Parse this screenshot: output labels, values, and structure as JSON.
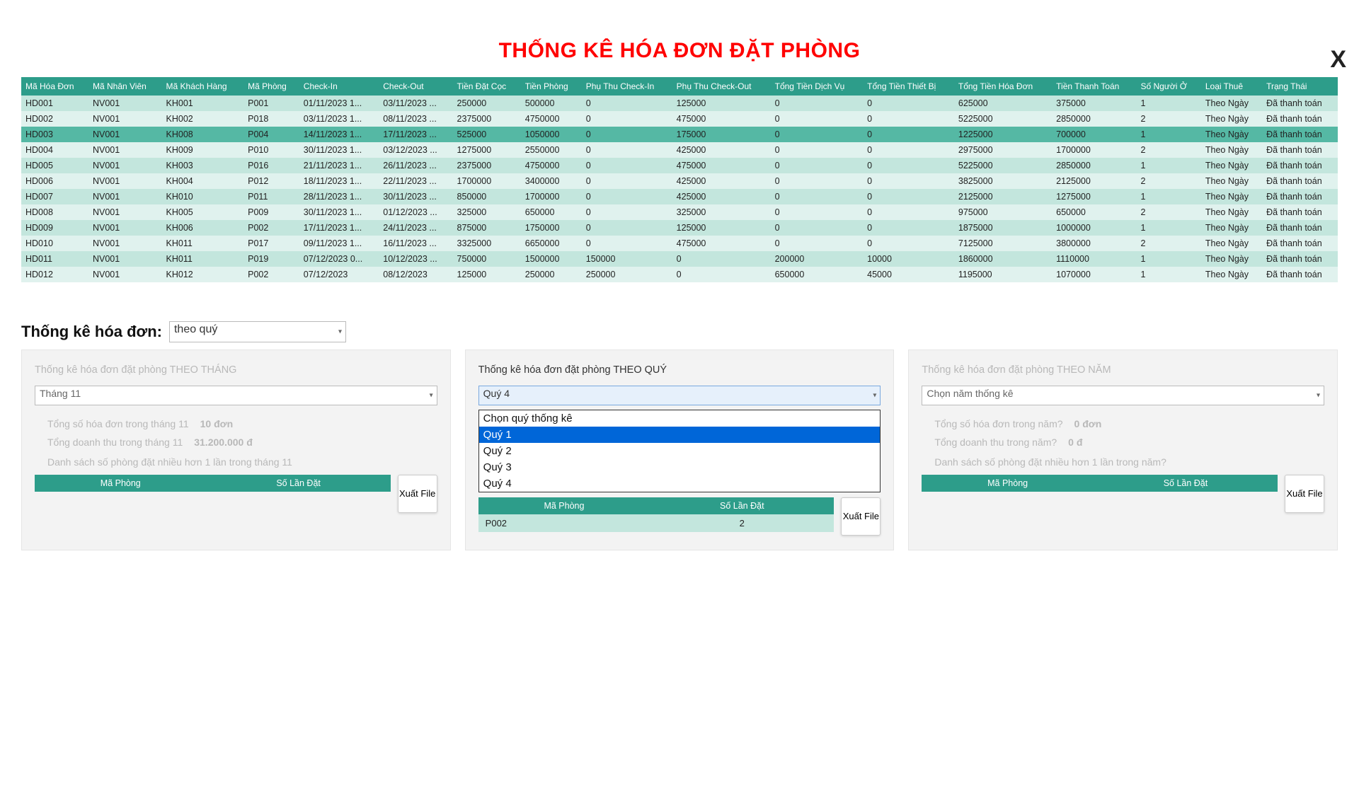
{
  "close_label": "X",
  "title": "THỐNG KÊ HÓA ĐƠN ĐẶT PHÒNG",
  "columns": [
    "Mã Hóa Đơn",
    "Mã Nhân Viên",
    "Mã Khách Hàng",
    "Mã Phòng",
    "Check-In",
    "Check-Out",
    "Tiền Đặt Cọc",
    "Tiền Phòng",
    "Phụ Thu Check-In",
    "Phụ Thu Check-Out",
    "Tổng Tiền Dịch Vụ",
    "Tổng Tiền Thiết Bị",
    "Tổng Tiền Hóa Đơn",
    "Tiền Thanh Toán",
    "Số Người Ở",
    "Loại Thuê",
    "Trạng Thái"
  ],
  "rows": [
    [
      "HD001",
      "NV001",
      "KH001",
      "P001",
      "01/11/2023 1...",
      "03/11/2023 ...",
      "250000",
      "500000",
      "0",
      "125000",
      "0",
      "0",
      "625000",
      "375000",
      "1",
      "Theo Ngày",
      "Đã thanh toán"
    ],
    [
      "HD002",
      "NV001",
      "KH002",
      "P018",
      "03/11/2023 1...",
      "08/11/2023 ...",
      "2375000",
      "4750000",
      "0",
      "475000",
      "0",
      "0",
      "5225000",
      "2850000",
      "2",
      "Theo Ngày",
      "Đã thanh toán"
    ],
    [
      "HD003",
      "NV001",
      "KH008",
      "P004",
      "14/11/2023 1...",
      "17/11/2023 ...",
      "525000",
      "1050000",
      "0",
      "175000",
      "0",
      "0",
      "1225000",
      "700000",
      "1",
      "Theo Ngày",
      "Đã thanh toán"
    ],
    [
      "HD004",
      "NV001",
      "KH009",
      "P010",
      "30/11/2023 1...",
      "03/12/2023 ...",
      "1275000",
      "2550000",
      "0",
      "425000",
      "0",
      "0",
      "2975000",
      "1700000",
      "2",
      "Theo Ngày",
      "Đã thanh toán"
    ],
    [
      "HD005",
      "NV001",
      "KH003",
      "P016",
      "21/11/2023 1...",
      "26/11/2023 ...",
      "2375000",
      "4750000",
      "0",
      "475000",
      "0",
      "0",
      "5225000",
      "2850000",
      "1",
      "Theo Ngày",
      "Đã thanh toán"
    ],
    [
      "HD006",
      "NV001",
      "KH004",
      "P012",
      "18/11/2023 1...",
      "22/11/2023 ...",
      "1700000",
      "3400000",
      "0",
      "425000",
      "0",
      "0",
      "3825000",
      "2125000",
      "2",
      "Theo Ngày",
      "Đã thanh toán"
    ],
    [
      "HD007",
      "NV001",
      "KH010",
      "P011",
      "28/11/2023 1...",
      "30/11/2023 ...",
      "850000",
      "1700000",
      "0",
      "425000",
      "0",
      "0",
      "2125000",
      "1275000",
      "1",
      "Theo Ngày",
      "Đã thanh toán"
    ],
    [
      "HD008",
      "NV001",
      "KH005",
      "P009",
      "30/11/2023 1...",
      "01/12/2023 ...",
      "325000",
      "650000",
      "0",
      "325000",
      "0",
      "0",
      "975000",
      "650000",
      "2",
      "Theo Ngày",
      "Đã thanh toán"
    ],
    [
      "HD009",
      "NV001",
      "KH006",
      "P002",
      "17/11/2023 1...",
      "24/11/2023 ...",
      "875000",
      "1750000",
      "0",
      "125000",
      "0",
      "0",
      "1875000",
      "1000000",
      "1",
      "Theo Ngày",
      "Đã thanh toán"
    ],
    [
      "HD010",
      "NV001",
      "KH011",
      "P017",
      "09/11/2023 1...",
      "16/11/2023 ...",
      "3325000",
      "6650000",
      "0",
      "475000",
      "0",
      "0",
      "7125000",
      "3800000",
      "2",
      "Theo Ngày",
      "Đã thanh toán"
    ],
    [
      "HD011",
      "NV001",
      "KH011",
      "P019",
      "07/12/2023 0...",
      "10/12/2023 ...",
      "750000",
      "1500000",
      "150000",
      "0",
      "200000",
      "10000",
      "1860000",
      "1110000",
      "1",
      "Theo Ngày",
      "Đã thanh toán"
    ],
    [
      "HD012",
      "NV001",
      "KH012",
      "P002",
      "07/12/2023",
      "08/12/2023",
      "125000",
      "250000",
      "250000",
      "0",
      "650000",
      "45000",
      "1195000",
      "1070000",
      "1",
      "Theo Ngày",
      "Đã thanh toán"
    ]
  ],
  "selected_row_index": 2,
  "stats_label": "Thống kê hóa đơn:",
  "stats_select_value": "theo quý",
  "export_label": "Xuất File",
  "mini_columns": [
    "Mã Phòng",
    "Số Lần Đặt"
  ],
  "panel_month": {
    "title": "Thống kê hóa đơn đặt phòng THEO THÁNG",
    "select_value": "Tháng 11",
    "line1_label": "Tổng số hóa đơn trong tháng 11",
    "line1_value": "10 đơn",
    "line2_label": "Tổng doanh thu trong tháng 11",
    "line2_value": "31.200.000 đ",
    "caption": "Danh sách số phòng đặt nhiều hơn 1 lần trong tháng 11"
  },
  "panel_quarter": {
    "title": "Thống kê hóa đơn đặt phòng THEO QUÝ",
    "select_value": "Quý 4",
    "options": [
      "Chọn quý thống kê",
      "Quý 1",
      "Quý 2",
      "Quý 3",
      "Quý 4"
    ],
    "highlight_index": 1,
    "mini_rows": [
      [
        "P002",
        "2"
      ]
    ]
  },
  "panel_year": {
    "title": "Thống kê hóa đơn đặt phòng THEO NĂM",
    "select_value": "Chọn năm thống kê",
    "line1_label": "Tổng số hóa đơn trong năm?",
    "line1_value": "0 đơn",
    "line2_label": "Tổng doanh thu trong năm?",
    "line2_value": "0 đ",
    "caption": "Danh sách số phòng đặt nhiều hơn 1 lần trong năm?"
  }
}
